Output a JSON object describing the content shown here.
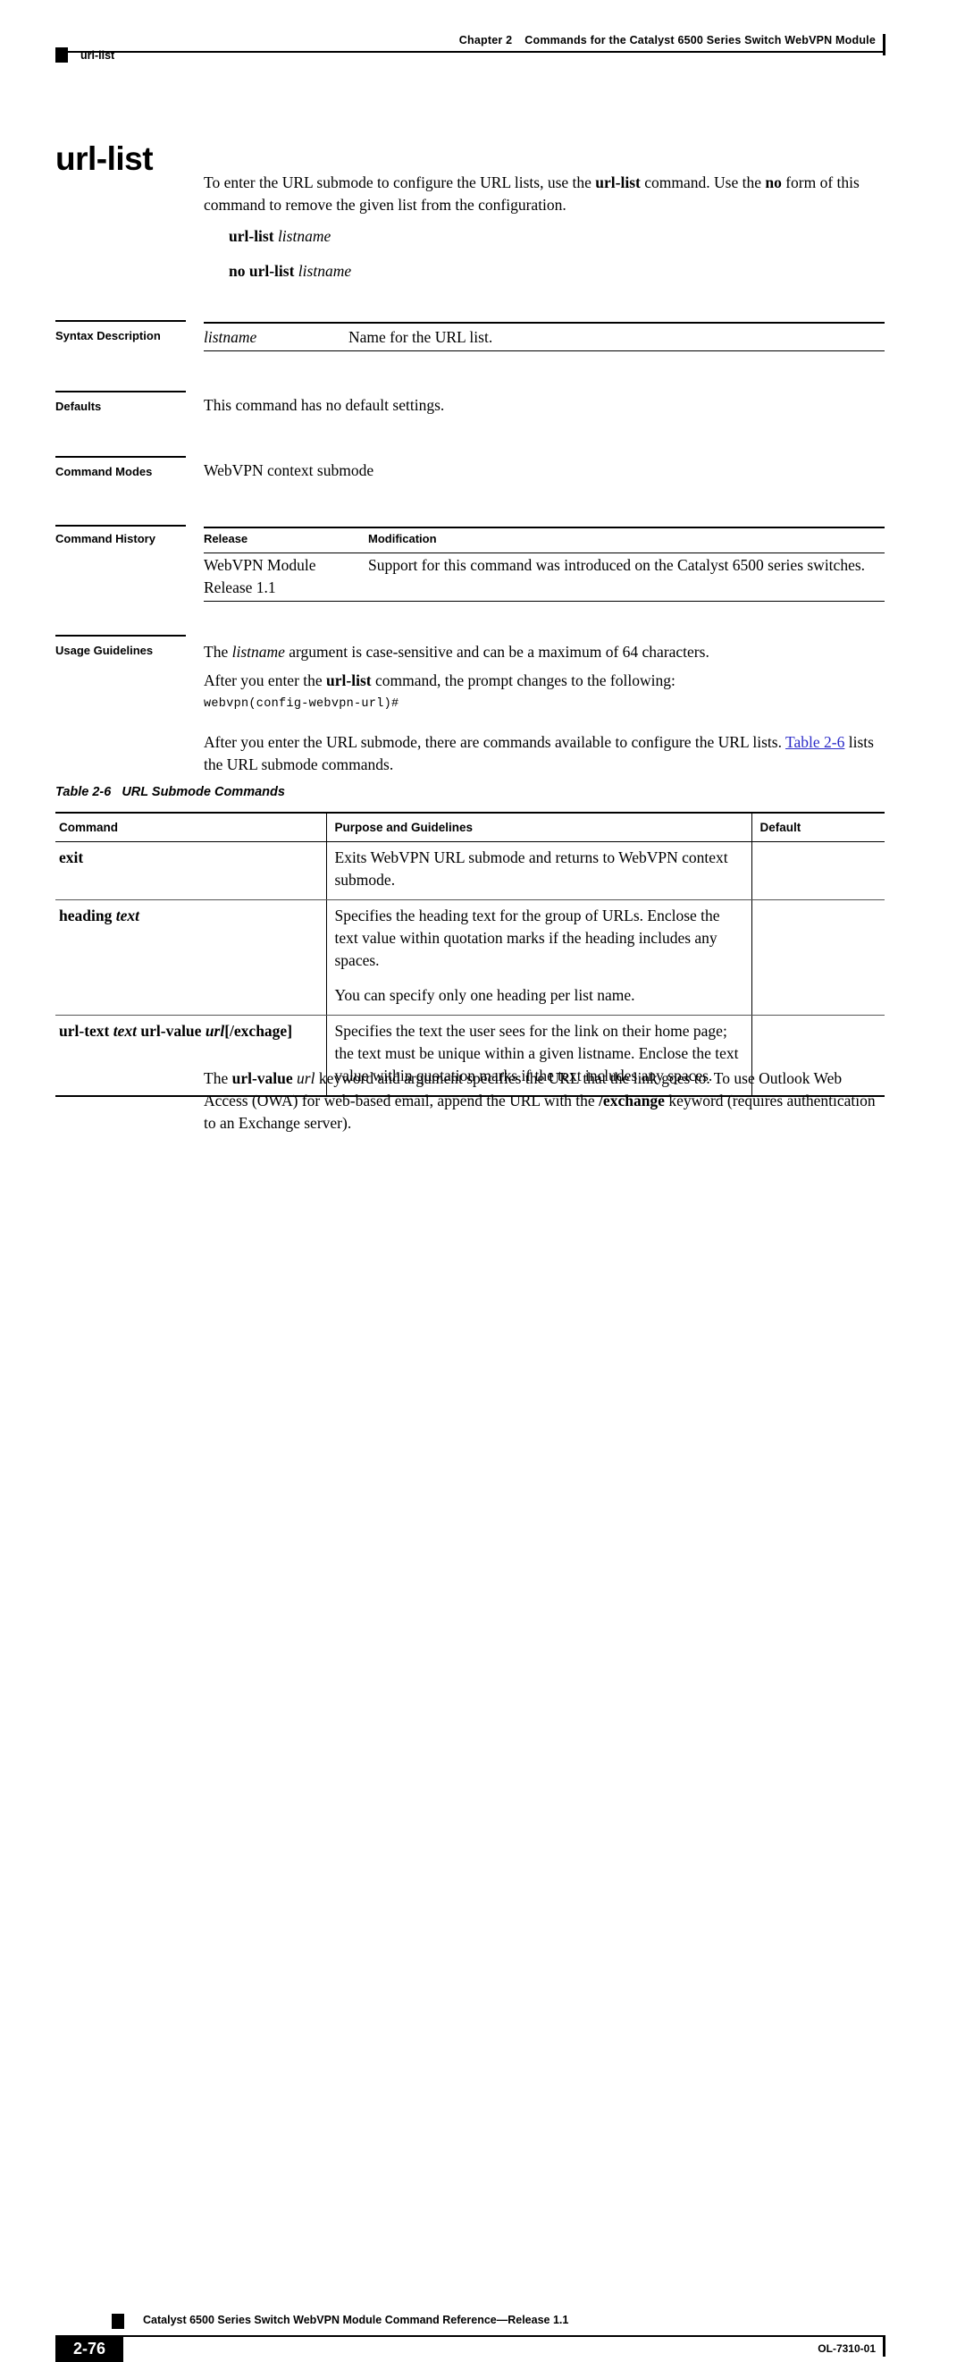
{
  "header": {
    "chapter_label": "Chapter 2",
    "chapter_title": "Commands for the Catalyst 6500 Series Switch WebVPN Module",
    "running_head": "url-list"
  },
  "page_title": "url-list",
  "intro": {
    "p1_a": "To enter the URL submode to configure the URL lists, use the ",
    "p1_cmd": "url-list",
    "p1_b": " command. Use the ",
    "p1_no": "no",
    "p1_c": " form of this command to remove the given list from the configuration."
  },
  "syntax_lines": {
    "line1_cmd": "url-list",
    "line1_arg": "listname",
    "line2_cmd": "no url-list",
    "line2_arg": "listname"
  },
  "sections": {
    "syntax_description": {
      "label": "Syntax Description",
      "term": "listname",
      "description": "Name for the URL list."
    },
    "defaults": {
      "label": "Defaults",
      "text": "This command has no default settings."
    },
    "command_modes": {
      "label": "Command Modes",
      "text": "WebVPN context submode"
    },
    "command_history": {
      "label": "Command History",
      "columns": [
        "Release",
        "Modification"
      ],
      "rows": [
        {
          "release": "WebVPN Module Release 1.1",
          "modification": "Support for this command was introduced on the Catalyst 6500 series switches."
        }
      ]
    },
    "usage_guidelines": {
      "label": "Usage Guidelines",
      "p1_a": "The ",
      "p1_arg": "listname",
      "p1_b": " argument is case-sensitive and can be a maximum of 64 characters.",
      "p2_a": "After you enter the ",
      "p2_cmd": "url-list",
      "p2_b": " command, the prompt changes to the following:",
      "code": "webvpn(config-webvpn-url)#",
      "p3_a": "After you enter the URL submode, there are commands available to configure the URL lists. ",
      "p3_link": "Table 2-6",
      "p3_b": " lists the URL submode commands."
    }
  },
  "table": {
    "caption_number": "Table 2-6",
    "caption_title": "URL Submode Commands",
    "columns": [
      "Command",
      "Purpose and Guidelines",
      "Default"
    ],
    "rows": [
      {
        "command_bold": "exit",
        "command_italic": "",
        "command_bold2": "",
        "command_italic2": "",
        "command_tail": "",
        "purpose_paragraphs": [
          "Exits WebVPN URL submode and returns to WebVPN context submode."
        ],
        "default": ""
      },
      {
        "command_bold": "heading",
        "command_italic": " text",
        "command_bold2": "",
        "command_italic2": "",
        "command_tail": "",
        "purpose_paragraphs": [
          "Specifies the heading text for the group of URLs. Enclose the text value within quotation marks if the heading includes any spaces.",
          "You can specify only one heading per list name."
        ],
        "default": ""
      },
      {
        "command_bold": "url-text",
        "command_italic": " text ",
        "command_bold2": "url-value",
        "command_italic2": " url",
        "command_tail": "[/exchage]",
        "purpose_paragraphs": [
          "Specifies the text the user sees for the link on their home page; the text must be unique within a given listname. Enclose the text value within quotation marks if the text includes any spaces."
        ],
        "default": ""
      }
    ]
  },
  "tail_paragraph": {
    "a": "The ",
    "cmd": "url-value",
    "b": " ",
    "arg": "url",
    "c": " keyword and argument specifies the URL that the link goes to. To use Outlook Web Access (OWA) for web-based email, append the URL with the ",
    "kw": "/exchange",
    "d": " keyword (requires authentication to an Exchange server)."
  },
  "footer": {
    "doc_title": "Catalyst 6500 Series Switch WebVPN Module Command Reference—Release 1.1",
    "page_number": "2-76",
    "doc_id": "OL-7310-01"
  },
  "colors": {
    "link": "#2b2bc8",
    "rule": "#000000"
  }
}
